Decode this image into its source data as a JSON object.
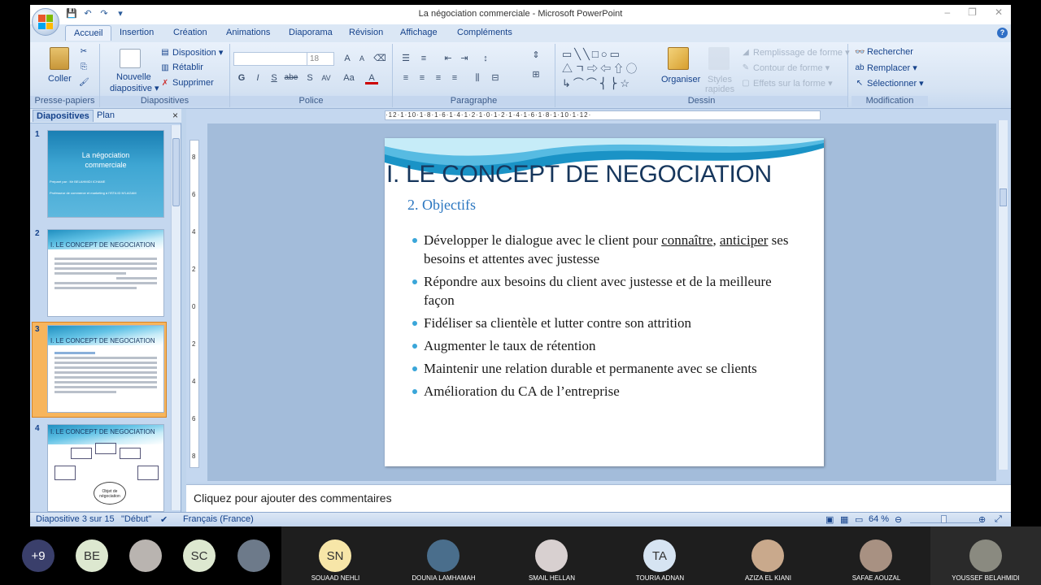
{
  "window": {
    "title": "La négociation commerciale - Microsoft PowerPoint",
    "controls": [
      "–",
      "❐",
      "✕"
    ]
  },
  "qat": {
    "icons": [
      "save-icon",
      "undo-icon",
      "redo-icon",
      "customize-icon"
    ]
  },
  "tabs": [
    "Accueil",
    "Insertion",
    "Création",
    "Animations",
    "Diaporama",
    "Révision",
    "Affichage",
    "Compléments"
  ],
  "ribbon": {
    "presse_papiers": {
      "label": "Presse-papiers",
      "coller": "Coller"
    },
    "diapositives": {
      "label": "Diapositives",
      "nouvelle": "Nouvelle",
      "diapositive": "diapositive",
      "disposition": "Disposition",
      "retablir": "Rétablir",
      "supprimer": "Supprimer"
    },
    "police": {
      "label": "Police",
      "font_size": "18",
      "buttons": [
        "G",
        "I",
        "S",
        "abe",
        "S",
        "AV",
        "Aa",
        "A"
      ]
    },
    "paragraphe": {
      "label": "Paragraphe"
    },
    "dessin": {
      "label": "Dessin",
      "organiser": "Organiser",
      "styles": "Styles",
      "rapides": "rapides",
      "remplissage": "Remplissage de forme",
      "contour": "Contour de forme",
      "effets": "Effets sur la forme"
    },
    "modification": {
      "label": "Modification",
      "rechercher": "Rechercher",
      "remplacer": "Remplacer",
      "selectionner": "Sélectionner"
    }
  },
  "panel": {
    "tab_slides": "Diapositives",
    "tab_plan": "Plan",
    "close": "×",
    "thumbs": [
      {
        "num": "1",
        "title": "La négociation commerciale",
        "sub1": "Préparé par : Mr BELAHMIDI ICHAME",
        "sub2": "Professeur de commerce et marketing à l'ISTA ID M'LAGAM"
      },
      {
        "num": "2",
        "title": "I. LE CONCEPT DE NEGOCIATION"
      },
      {
        "num": "3",
        "title": "I. LE CONCEPT DE NEGOCIATION"
      },
      {
        "num": "4",
        "title": "I. LE CONCEPT DE NEGOCIATION",
        "center": "Objet de négociation"
      }
    ]
  },
  "rulers": {
    "h": "·12·1·10·1·8·1·6·1·4·1·2·1·0·1·2·1·4·1·6·1·8·1·10·1·12·",
    "v": [
      "8",
      "6",
      "4",
      "2",
      "0",
      "2",
      "4",
      "6",
      "8"
    ]
  },
  "slide": {
    "title": "I. LE CONCEPT DE NEGOCIATION",
    "subtitle": "2. Objectifs",
    "b1_pre": "Développer le dialogue avec le client pour ",
    "b1_u1": "connaître",
    "b1_mid": ", ",
    "b1_u2": "anticiper",
    "b1_post": " ses besoins et attentes avec justesse",
    "bullets": [
      "Répondre aux besoins du client avec justesse et de la meilleure façon",
      "Fidéliser sa clientèle et lutter contre son attrition",
      "Augmenter le taux de rétention",
      "Maintenir une relation durable et permanente avec se clients",
      "Amélioration du CA de l’entreprise"
    ]
  },
  "notes": {
    "placeholder": "Cliquez pour ajouter des commentaires"
  },
  "status": {
    "slide_info": "Diapositive 3 sur 15",
    "theme": "\"Début\"",
    "language": "Français (France)",
    "zoom": "64 %"
  },
  "participants": [
    {
      "initials": "+9",
      "name": "",
      "color": "#3a3f6b",
      "text_color": "#ffffff"
    },
    {
      "initials": "BE",
      "name": "",
      "color": "#dde8d0",
      "text_color": "#333333"
    },
    {
      "initials": "",
      "name": "",
      "color": "#b9b4b0",
      "text_color": "#333333"
    },
    {
      "initials": "SC",
      "name": "",
      "color": "#dde8d0",
      "text_color": "#333333"
    },
    {
      "initials": "",
      "name": "",
      "color": "#6d7a8a",
      "text_color": "#333333"
    },
    {
      "initials": "SN",
      "name": "SOUAAD NEHLI",
      "color": "#f7e6a8",
      "text_color": "#333333"
    },
    {
      "initials": "",
      "name": "DOUNIA LAMHAMAH",
      "color": "#4a6e8c",
      "text_color": "#333333"
    },
    {
      "initials": "",
      "name": "SMAIL HELLAN",
      "color": "#d8d0d0",
      "text_color": "#333333"
    },
    {
      "initials": "TA",
      "name": "TOURIA ADNAN",
      "color": "#d6e4f2",
      "text_color": "#333333"
    },
    {
      "initials": "",
      "name": "AZIZA EL KIANI",
      "color": "#c9a98c",
      "text_color": "#333333"
    },
    {
      "initials": "",
      "name": "SAFAE AOUZAL",
      "color": "#a89182",
      "text_color": "#333333"
    },
    {
      "initials": "",
      "name": "YOUSSEF BELAHMIDI",
      "color": "#8a8a80",
      "text_color": "#333333"
    }
  ]
}
